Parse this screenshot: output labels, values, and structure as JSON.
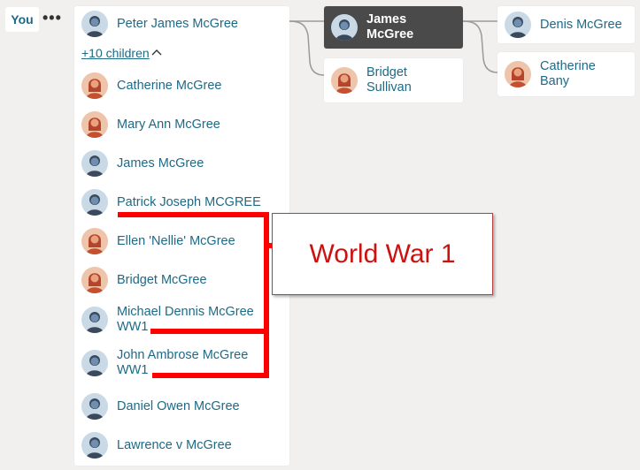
{
  "you_label": "You",
  "more_dots": "•••",
  "focus_person": {
    "name": "Peter James McGree",
    "sex": "male"
  },
  "children_toggle": {
    "label": "+10 children",
    "icon": "chevron-up-icon"
  },
  "children": [
    {
      "name": "Catherine McGree",
      "sex": "female"
    },
    {
      "name": "Mary Ann McGree",
      "sex": "female"
    },
    {
      "name": "James McGree",
      "sex": "male"
    },
    {
      "name": "Patrick Joseph MCGREE",
      "sex": "male"
    },
    {
      "name": "Ellen 'Nellie' McGree",
      "sex": "female"
    },
    {
      "name": "Bridget McGree",
      "sex": "female"
    },
    {
      "name": "Michael Dennis McGree WW1",
      "sex": "male"
    },
    {
      "name": "John Ambrose McGree WW1",
      "sex": "male"
    },
    {
      "name": "Daniel Owen McGree",
      "sex": "male"
    },
    {
      "name": "Lawrence v McGree",
      "sex": "male"
    }
  ],
  "parents": [
    {
      "name": "James McGree",
      "sex": "male",
      "selected": true
    },
    {
      "name": "Bridget Sullivan",
      "sex": "female",
      "selected": false
    }
  ],
  "grandparents": [
    {
      "name": "Denis McGree",
      "sex": "male"
    },
    {
      "name": "Catherine Bany",
      "sex": "female"
    }
  ],
  "annotation": {
    "text": "World War 1",
    "color": "#cc1111"
  },
  "colors": {
    "link": "#1d6a86",
    "selected_card": "#4a4a4a",
    "male_avatar_bg": "#c9d9e6",
    "female_avatar_bg": "#eec4ab",
    "annotation_line": "#ff0000"
  }
}
